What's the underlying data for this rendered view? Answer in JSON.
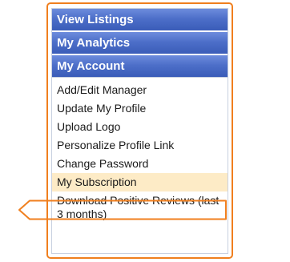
{
  "menu": {
    "headers": [
      {
        "label": "View Listings"
      },
      {
        "label": "My Analytics"
      },
      {
        "label": "My Account"
      }
    ],
    "account_items": [
      {
        "label": "Add/Edit Manager"
      },
      {
        "label": "Update My Profile"
      },
      {
        "label": "Upload Logo"
      },
      {
        "label": "Personalize Profile Link"
      },
      {
        "label": "Change Password"
      },
      {
        "label": "My Subscription",
        "highlighted": true
      },
      {
        "label": "Download Positive Reviews (last 3 months)"
      }
    ]
  },
  "colors": {
    "header_blue": "#4d6fc9",
    "highlight_orange": "#f07f1e",
    "highlight_fill": "#fdebc6"
  },
  "icons": {
    "callout": "left-arrow-callout-icon"
  }
}
